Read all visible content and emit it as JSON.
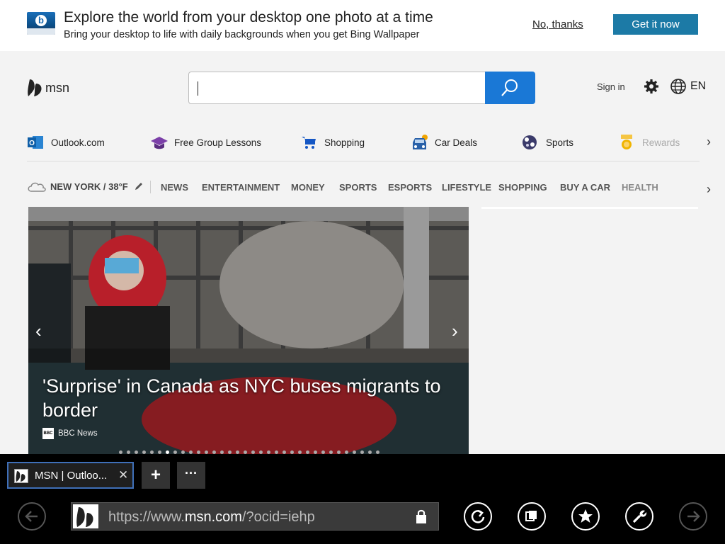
{
  "banner": {
    "title": "Explore the world from your desktop one photo at a time",
    "subtitle": "Bring your desktop to life with daily backgrounds when you get Bing Wallpaper",
    "no_thanks": "No, thanks",
    "get_it_now": "Get it now"
  },
  "header": {
    "logo_text": "msn",
    "search_placeholder": "",
    "sign_in": "Sign in",
    "language": "EN"
  },
  "quick_links": [
    {
      "label": "Outlook.com",
      "icon": "outlook-icon"
    },
    {
      "label": "Free Group Lessons",
      "icon": "graduation-cap-icon"
    },
    {
      "label": "Shopping",
      "icon": "shopping-cart-icon"
    },
    {
      "label": "Car Deals",
      "icon": "car-icon"
    },
    {
      "label": "Sports",
      "icon": "sports-ball-icon"
    },
    {
      "label": "Rewards",
      "icon": "medal-icon"
    }
  ],
  "weather": {
    "label": "NEW YORK / 38°F"
  },
  "nav": [
    "NEWS",
    "ENTERTAINMENT",
    "MONEY",
    "SPORTS",
    "ESPORTS",
    "LIFESTYLE",
    "SHOPPING",
    "BUY A CAR",
    "HEALTH"
  ],
  "hero": {
    "title": "'Surprise' in Canada as NYC buses migrants to border",
    "source_logo": "BBC",
    "source": "BBC News"
  },
  "browser": {
    "tab_title": "MSN | Outloo...",
    "close_glyph": "✕",
    "new_tab_glyph": "+",
    "more_glyph": "···",
    "url_prefix": "https://www.",
    "url_domain": "msn.com",
    "url_suffix": "/?ocid=iehp"
  },
  "colors": {
    "accent_blue": "#1a78d6",
    "get_it_button": "#1c7aa6",
    "tab_border": "#3f6fb8"
  }
}
